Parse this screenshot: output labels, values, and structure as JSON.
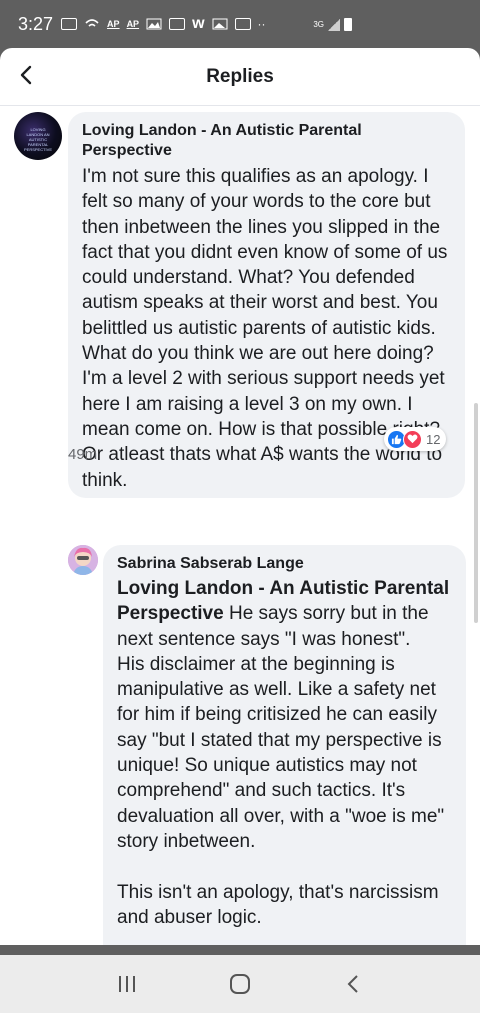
{
  "status_bar": {
    "time": "3:27",
    "icons": [
      "message-icon",
      "wifi-call-icon",
      "ap-icon",
      "ap-icon",
      "image-icon",
      "radio-icon",
      "w-icon",
      "gallery-icon",
      "window-icon",
      "more-dots-icon"
    ],
    "ap_label": "AP",
    "w_label": "w",
    "dots_label": "··",
    "network_label": "3G"
  },
  "header": {
    "title": "Replies"
  },
  "comment1": {
    "author": "Loving Landon - An Autistic Parental Perspective",
    "text": "I'm not sure this qualifies as an apology. I felt so many of your words to the core but then inbetween the lines you slipped in the fact that you didnt even know of some of us could understand. What? You defended autism speaks at their worst and best. You belittled us autistic parents of autistic kids. What do you think we are out here doing? I'm a level 2 with serious support needs yet here I am raising a level 3 on my own. I mean come on. How is that possible right? Or atleast thats what A$ wants the world to think.",
    "time": "49m",
    "reaction_count": "12",
    "avatar_text": "LOVING LANDON AN AUTISTIC PARENTAL PERSPECTIVE"
  },
  "comment2": {
    "author": "Sabrina Sabserab Lange",
    "mention": "Loving Landon - An Autistic Parental Perspective",
    "text_after_mention": " He says sorry but in the next sentence says \"I was honest\".\nHis disclaimer at the beginning is manipulative as well. Like a safety net for him if being critisized he can easily say \"but I stated that my perspective is unique! So unique autistics may not comprehend\"  and such tactics. It's devaluation all over, with a \"woe is me\" story inbetween.\n\nThis isn't an apology, that's narcissism and abuser logic."
  },
  "colors": {
    "bubble": "#f0f2f5",
    "like": "#1877f2",
    "love": "#f33e58",
    "status_bar": "#5f5f5f"
  }
}
